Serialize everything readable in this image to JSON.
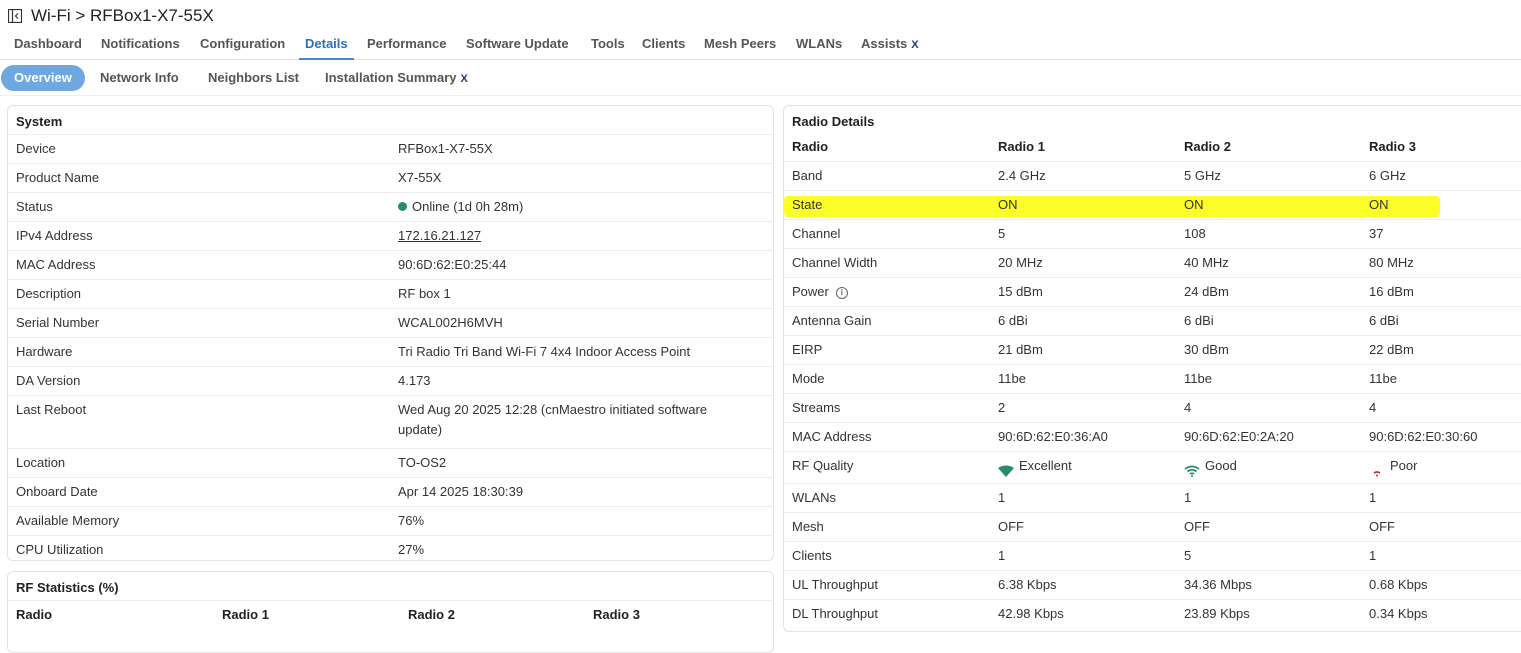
{
  "header": {
    "title": "Wi-Fi > RFBox1-X7-55X"
  },
  "tabs": [
    {
      "label": "Dashboard"
    },
    {
      "label": "Notifications"
    },
    {
      "label": "Configuration"
    },
    {
      "label": "Details"
    },
    {
      "label": "Performance"
    },
    {
      "label": "Software Update"
    },
    {
      "label": "Tools"
    },
    {
      "label": "Clients"
    },
    {
      "label": "Mesh Peers"
    },
    {
      "label": "WLANs"
    },
    {
      "label": "Assists",
      "badge": "X"
    }
  ],
  "subtabs": [
    {
      "label": "Overview"
    },
    {
      "label": "Network Info"
    },
    {
      "label": "Neighbors List"
    },
    {
      "label": "Installation Summary",
      "badge": "X"
    }
  ],
  "system": {
    "title": "System",
    "rows": [
      {
        "label": "Device",
        "value": "RFBox1-X7-55X"
      },
      {
        "label": "Product Name",
        "value": "X7-55X"
      },
      {
        "label": "Status",
        "value": "Online (1d 0h 28m)"
      },
      {
        "label": "IPv4 Address",
        "value": "172.16.21.127"
      },
      {
        "label": "MAC Address",
        "value": "90:6D:62:E0:25:44"
      },
      {
        "label": "Description",
        "value": "RF box 1"
      },
      {
        "label": "Serial Number",
        "value": "WCAL002H6MVH"
      },
      {
        "label": "Hardware",
        "value": "Tri Radio Tri Band Wi-Fi 7 4x4 Indoor Access Point"
      },
      {
        "label": "DA Version",
        "value": "4.173"
      },
      {
        "label": "Last Reboot",
        "value": "Wed Aug 20 2025 12:28 (cnMaestro initiated software update)"
      },
      {
        "label": "Location",
        "value": "TO-OS2"
      },
      {
        "label": "Onboard Date",
        "value": "Apr 14 2025 18:30:39"
      },
      {
        "label": "Available Memory",
        "value": "76%"
      },
      {
        "label": "CPU Utilization",
        "value": "27%"
      }
    ]
  },
  "rf_stats": {
    "title": "RF Statistics (%)",
    "headers": [
      "Radio",
      "Radio 1",
      "Radio 2",
      "Radio 3"
    ]
  },
  "radio": {
    "title": "Radio Details",
    "headers": [
      "Radio",
      "Radio 1",
      "Radio 2",
      "Radio 3"
    ],
    "rows": [
      {
        "label": "Band",
        "v": [
          "2.4 GHz",
          "5 GHz",
          "6 GHz"
        ]
      },
      {
        "label": "State",
        "v": [
          "ON",
          "ON",
          "ON"
        ]
      },
      {
        "label": "Channel",
        "v": [
          "5",
          "108",
          "37"
        ]
      },
      {
        "label": "Channel Width",
        "v": [
          "20 MHz",
          "40 MHz",
          "80 MHz"
        ]
      },
      {
        "label": "Power",
        "v": [
          "15 dBm",
          "24 dBm",
          "16 dBm"
        ]
      },
      {
        "label": "Antenna Gain",
        "v": [
          "6 dBi",
          "6 dBi",
          "6 dBi"
        ]
      },
      {
        "label": "EIRP",
        "v": [
          "21 dBm",
          "30 dBm",
          "22 dBm"
        ]
      },
      {
        "label": "Mode",
        "v": [
          "11be",
          "11be",
          "11be"
        ]
      },
      {
        "label": "Streams",
        "v": [
          "2",
          "4",
          "4"
        ]
      },
      {
        "label": "MAC Address",
        "v": [
          "90:6D:62:E0:36:A0",
          "90:6D:62:E0:2A:20",
          "90:6D:62:E0:30:60"
        ]
      },
      {
        "label": "RF Quality",
        "v": [
          "Excellent",
          "Good",
          "Poor"
        ]
      },
      {
        "label": "WLANs",
        "v": [
          "1",
          "1",
          "1"
        ]
      },
      {
        "label": "Mesh",
        "v": [
          "OFF",
          "OFF",
          "OFF"
        ]
      },
      {
        "label": "Clients",
        "v": [
          "1",
          "5",
          "1"
        ]
      },
      {
        "label": "UL Throughput",
        "v": [
          "6.38 Kbps",
          "34.36 Mbps",
          "0.68 Kbps"
        ]
      },
      {
        "label": "DL Throughput",
        "v": [
          "42.98 Kbps",
          "23.89 Kbps",
          "0.34 Kbps"
        ]
      }
    ]
  },
  "colors": {
    "accent": "#4a86d0",
    "online": "#2a8a6a",
    "highlight": "#fbfc28",
    "rf_excellent": "#2a8a6a",
    "rf_good": "#2a8a6a",
    "rf_poor": "#c0303a"
  }
}
